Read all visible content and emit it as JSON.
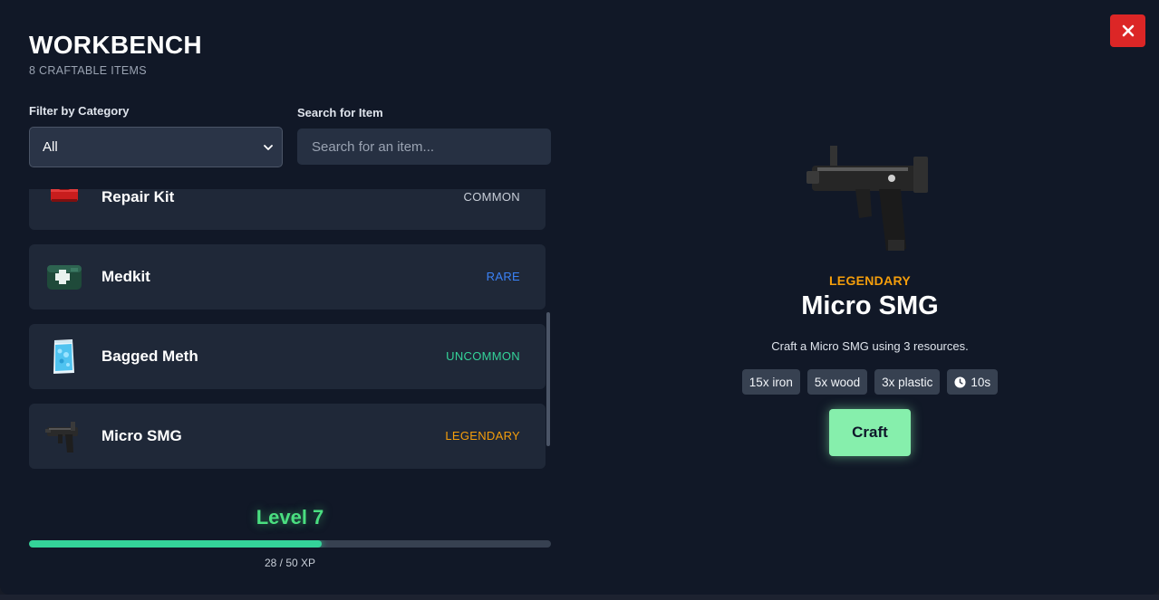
{
  "header": {
    "title": "WORKBENCH",
    "subtitle": "8 CRAFTABLE ITEMS"
  },
  "filters": {
    "category_label": "Filter by Category",
    "category_value": "All",
    "search_label": "Search for Item",
    "search_placeholder": "Search for an item..."
  },
  "items": [
    {
      "name": "Repair Kit",
      "rarity": "COMMON",
      "rarity_color": "#c8ced8",
      "icon": "toolbox-icon"
    },
    {
      "name": "Medkit",
      "rarity": "RARE",
      "rarity_color": "#3b82f6",
      "icon": "medkit-icon"
    },
    {
      "name": "Bagged Meth",
      "rarity": "UNCOMMON",
      "rarity_color": "#34d399",
      "icon": "crystal-bag-icon"
    },
    {
      "name": "Micro SMG",
      "rarity": "LEGENDARY",
      "rarity_color": "#f59e0b",
      "icon": "smg-icon"
    }
  ],
  "level": {
    "label": "Level 7",
    "xp_text": "28 / 50 XP",
    "xp_current": 28,
    "xp_max": 50
  },
  "selected": {
    "rarity": "LEGENDARY",
    "name": "Micro SMG",
    "description": "Craft a Micro SMG using 3 resources.",
    "resources": [
      "15x iron",
      "5x wood",
      "3x plastic"
    ],
    "time": "10s",
    "craft_label": "Craft",
    "icon": "smg-icon"
  },
  "colors": {
    "legendary": "#f59e0b",
    "rare": "#3b82f6",
    "uncommon": "#34d399",
    "common": "#c8ced8",
    "accent_green": "#4ade80",
    "close_red": "#dc2626"
  }
}
